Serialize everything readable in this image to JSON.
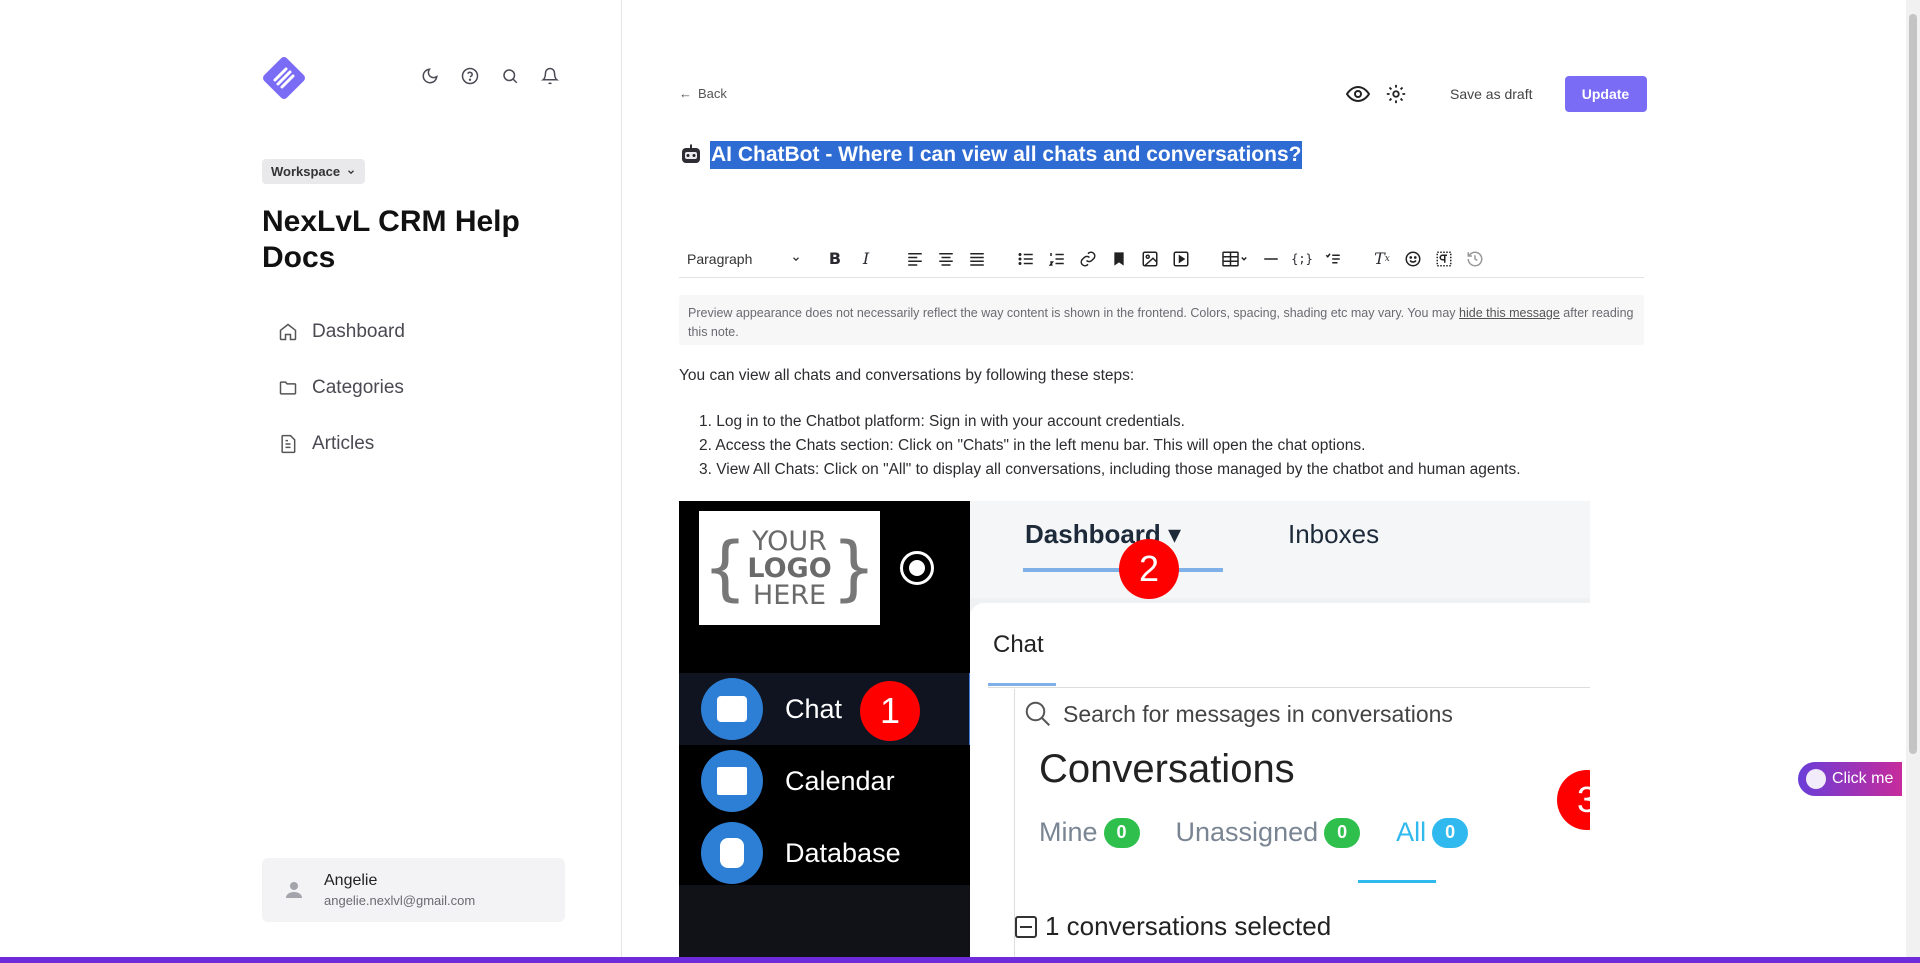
{
  "sidebar": {
    "workspace_label": "Workspace",
    "site_title": "NexLvL CRM Help Docs",
    "nav": [
      {
        "label": "Dashboard"
      },
      {
        "label": "Categories"
      },
      {
        "label": "Articles"
      }
    ],
    "user": {
      "name": "Angelie",
      "email": "angelie.nexlvl@gmail.com"
    }
  },
  "header": {
    "back_label": "Back",
    "save_draft_label": "Save as draft",
    "update_label": "Update"
  },
  "article": {
    "title": "AI ChatBot - Where I can view all chats and conversations?"
  },
  "editor": {
    "block_format": "Paragraph",
    "note_text": "Preview appearance does not necessarily reflect the way content is shown in the frontend. Colors, spacing, shading etc may vary. You may",
    "note_link": "hide this message",
    "note_tail": "after reading this note.",
    "intro": "You can view all chats and conversations by following these steps:",
    "steps": [
      "1. Log in to the Chatbot platform: Sign in with your account credentials.",
      "2. Access the Chats section: Click on \"Chats\" in the left menu bar. This will open the chat options.",
      "3. View All Chats: Click on \"All\" to display all conversations, including those managed by the chatbot and human agents."
    ]
  },
  "embedded_screenshot": {
    "logo_lines": [
      "YOUR",
      "LOGO",
      "HERE"
    ],
    "menu": [
      "Chat",
      "Calendar",
      "Database"
    ],
    "tabs": [
      "Dashboard",
      "Inboxes"
    ],
    "chat_tab": "Chat",
    "search_placeholder": "Search for messages in conversations",
    "heading": "Conversations",
    "filters": [
      {
        "label": "Mine",
        "count": "0"
      },
      {
        "label": "Unassigned",
        "count": "0"
      },
      {
        "label": "All",
        "count": "0"
      }
    ],
    "selected_text": "1 conversations selected",
    "markers": [
      "1",
      "2",
      "3"
    ]
  },
  "widget": {
    "label": "Click me"
  },
  "colors": {
    "accent": "#7b6cf6",
    "title_highlight": "#2e6bd3",
    "marker": "#ff0000",
    "bottom_bar": "#6d2bd9"
  }
}
